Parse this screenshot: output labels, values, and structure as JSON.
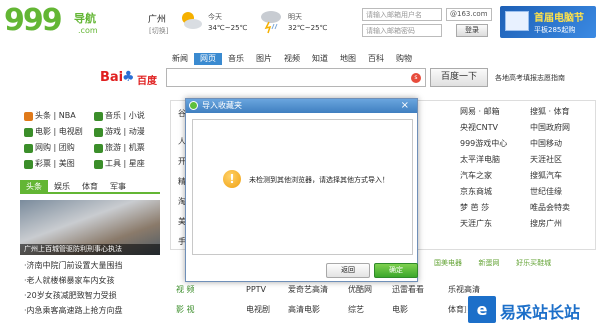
{
  "header": {
    "logo_main": "999",
    "logo_sub": "导航",
    "logo_com": ".com",
    "city": "广州",
    "city_switch": "[切换]",
    "today_label": "今天",
    "today_range": "34℃~25℃",
    "tomorrow_label": "明天",
    "tomorrow_range": "32℃~25℃",
    "mail_placeholder": "请输入邮箱用户名",
    "mail_domain": "@163.com",
    "password_placeholder": "请输入邮箱密码",
    "login_label": "登录",
    "ad_title": "首届电脑节",
    "ad_sub": "平板285起购"
  },
  "search": {
    "tabs": [
      "新闻",
      "网页",
      "音乐",
      "图片",
      "视频",
      "知道",
      "地图",
      "百科",
      "购物"
    ],
    "active_tab": 1,
    "brand_left": "Bai",
    "brand_paw": "♣",
    "brand_right": "百度",
    "button": "百度一下",
    "tip": "各地高考填报志愿指南"
  },
  "leftnav": [
    [
      {
        "label": "头条 | NBA",
        "color": "#e07a1a"
      },
      {
        "label": "音乐 | 小说",
        "color": "#3b8e2a"
      }
    ],
    [
      {
        "label": "电影 | 电视剧",
        "color": "#3b8e2a"
      },
      {
        "label": "游戏 | 动漫",
        "color": "#3b8e2a"
      }
    ],
    [
      {
        "label": "网购 | 团购",
        "color": "#3b8e2a"
      },
      {
        "label": "旅游 | 机票",
        "color": "#3b8e2a"
      }
    ],
    [
      {
        "label": "彩票 | 美图",
        "color": "#3b8e2a"
      },
      {
        "label": "工具 | 星座",
        "color": "#3b8e2a"
      }
    ]
  ],
  "left_tabs": [
    "头条",
    "娱乐",
    "体育",
    "军事"
  ],
  "photo_caption": "广州上百城管驱防利刑事心执法",
  "news": [
    "·济南中院门前设置大量围挡",
    "·老人就楼梯暴家车内女孩",
    "·20岁女孩减肥致智力受损",
    "·内急乘客高速路上抢方向盘"
  ],
  "right_cols": {
    "col1": [
      "网易 · 邮箱",
      "央视CNTV",
      "999游戏中心",
      "太平洋电脑",
      "汽车之家",
      "京东商城",
      "梦 芭 莎",
      "天涯广东"
    ],
    "col2": [
      "搜狐 · 体育",
      "中国政府网",
      "中国移动",
      "天涯社区",
      "搜狐汽车",
      "世纪佳缘",
      "唯品会特卖",
      "搜房广州"
    ],
    "left_chars": [
      "谷",
      "人",
      "开",
      "精",
      "淘",
      "美",
      "手"
    ]
  },
  "bar_links": [
    "国美电器",
    "新蛋网",
    "好乐买鞋城"
  ],
  "video_rows": [
    {
      "label": "视 频",
      "items": [
        "PPTV",
        "爱奇艺高清",
        "优酷网",
        "迅雷看看",
        "乐视高清"
      ]
    },
    {
      "label": "影 视",
      "items": [
        "电视剧",
        "高清电影",
        "综艺",
        "电影",
        "体育直播"
      ]
    }
  ],
  "dialog": {
    "title": "导入收藏夹",
    "close": "×",
    "warn_glyph": "!",
    "message": "未检测到其他浏览器，请选择其他方式导入！",
    "back": "返回",
    "ok": "确定"
  },
  "watermark": {
    "logo": "e",
    "text": "易采站长站"
  }
}
